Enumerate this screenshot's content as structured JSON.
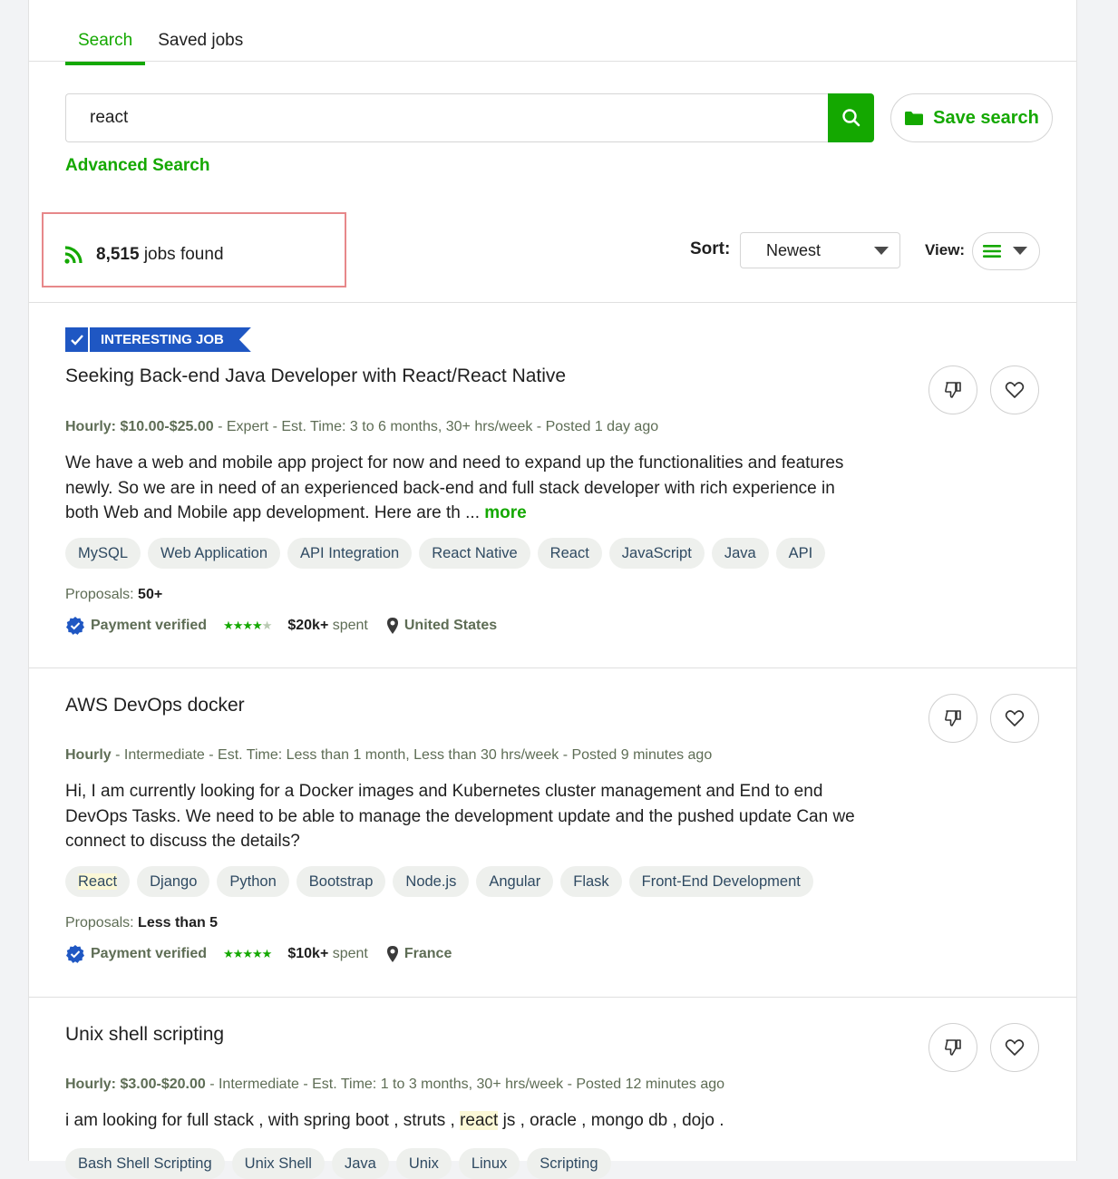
{
  "tabs": [
    {
      "label": "Search",
      "active": true
    },
    {
      "label": "Saved jobs",
      "active": false
    }
  ],
  "search": {
    "value": "react",
    "save_label": "Save search",
    "advanced_label": "Advanced Search"
  },
  "results": {
    "count": "8,515",
    "count_suffix": " jobs found",
    "sort_label": "Sort:",
    "sort_value": "Newest",
    "view_label": "View:"
  },
  "jobs": [
    {
      "badge": "INTERESTING JOB",
      "title": "Seeking Back-end Java Developer with React/React Native",
      "meta_strong": "Hourly: $10.00-$25.00",
      "meta_rest": " - Expert - Est. Time: 3 to 6 months, 30+ hrs/week - Posted 1 day ago",
      "description": "We have a web and mobile app project for now and need to expand up the functionalities and features newly. So we are in need of an experienced back-end and full stack developer with rich experience in both Web and Mobile app development. Here are th ...",
      "more": "more",
      "skills": [
        "MySQL",
        "Web Application",
        "API Integration",
        "React Native",
        "React",
        "JavaScript",
        "Java",
        "API"
      ],
      "proposals_label": "Proposals:",
      "proposals_value": "50+",
      "payment": "Payment verified",
      "rating": 4.5,
      "spent_amount": "$20k+",
      "spent_label": " spent",
      "location": "United States"
    },
    {
      "title": "AWS DevOps docker",
      "meta_strong": "Hourly",
      "meta_rest": " - Intermediate - Est. Time: Less than 1 month, Less than 30 hrs/week - Posted 9 minutes ago",
      "description": "Hi, I am currently looking for a Docker images and Kubernetes cluster management and End to end DevOps Tasks. We need to be able to manage the development update and the pushed update Can we connect to discuss the details?",
      "skills": [
        "React",
        "Django",
        "Python",
        "Bootstrap",
        "Node.js",
        "Angular",
        "Flask",
        "Front-End Development"
      ],
      "proposals_label": "Proposals:",
      "proposals_value": "Less than 5",
      "payment": "Payment verified",
      "rating": 5,
      "spent_amount": "$10k+",
      "spent_label": " spent",
      "location": "France"
    },
    {
      "title": "Unix shell scripting",
      "meta_strong": "Hourly: $3.00-$20.00",
      "meta_rest": " - Intermediate - Est. Time: 1 to 3 months, 30+ hrs/week - Posted 12 minutes ago",
      "desc_before": "i am looking for full stack , with spring boot , struts , ",
      "desc_highlight": "react",
      "desc_after": " js , oracle , mongo db , dojo .",
      "skills": [
        "Bash Shell Scripting",
        "Unix Shell",
        "Java",
        "Unix",
        "Linux",
        "Scripting"
      ]
    }
  ],
  "icons": {
    "search": "search-icon",
    "folder": "folder-icon",
    "rss": "rss-icon",
    "list_view": "list-view-icon",
    "thumbs_down": "thumbs-down-icon",
    "heart": "heart-icon",
    "verified": "verified-badge-icon",
    "location": "location-pin-icon"
  },
  "colors": {
    "brand": "#14a800",
    "badge_blue": "#1f57c3",
    "highlight_box": "#e7888a"
  }
}
